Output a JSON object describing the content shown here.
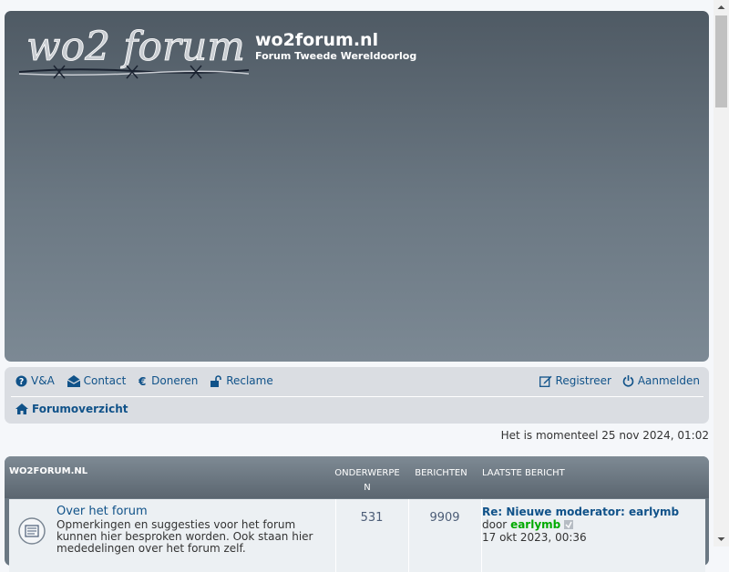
{
  "header": {
    "logo_text": "wo2 forum",
    "site_title": "wo2forum.nl",
    "site_description": "Forum Tweede Wereldoorlog"
  },
  "nav": {
    "left": [
      {
        "label": "V&A",
        "icon": "question-circle-icon"
      },
      {
        "label": "Contact",
        "icon": "envelope-open-icon"
      },
      {
        "label": "Doneren",
        "icon": "euro-icon"
      },
      {
        "label": "Reclame",
        "icon": "unlock-icon"
      }
    ],
    "right": [
      {
        "label": "Registreer",
        "icon": "edit-icon"
      },
      {
        "label": "Aanmelden",
        "icon": "power-icon"
      }
    ],
    "breadcrumb": "Forumoverzicht"
  },
  "timeline": "Het is momenteel 25 nov 2024, 01:02",
  "forum_table": {
    "category": "WO2FORUM.NL",
    "columns": {
      "topics": "ONDERWERPE N",
      "posts": "BERICHTEN",
      "last_post": "LAATSTE BERICHT"
    },
    "rows": [
      {
        "title": "Over het forum",
        "description": "Opmerkingen en suggesties voor het forum kunnen hier besproken worden. Ook staan hier mededelingen over het forum zelf.",
        "topics": "531",
        "posts": "9909",
        "last_post_title": "Re: Nieuwe moderator: earlymb",
        "last_post_by_prefix": "door",
        "last_post_user": "earlymb",
        "last_post_date": "17 okt 2023, 00:36"
      }
    ]
  },
  "colors": {
    "link": "#105289",
    "navbar_bg": "#dadde2",
    "header_gradient_top": "#4f5a64",
    "header_gradient_bottom": "#7c8994",
    "user_green": "#00aa00"
  }
}
